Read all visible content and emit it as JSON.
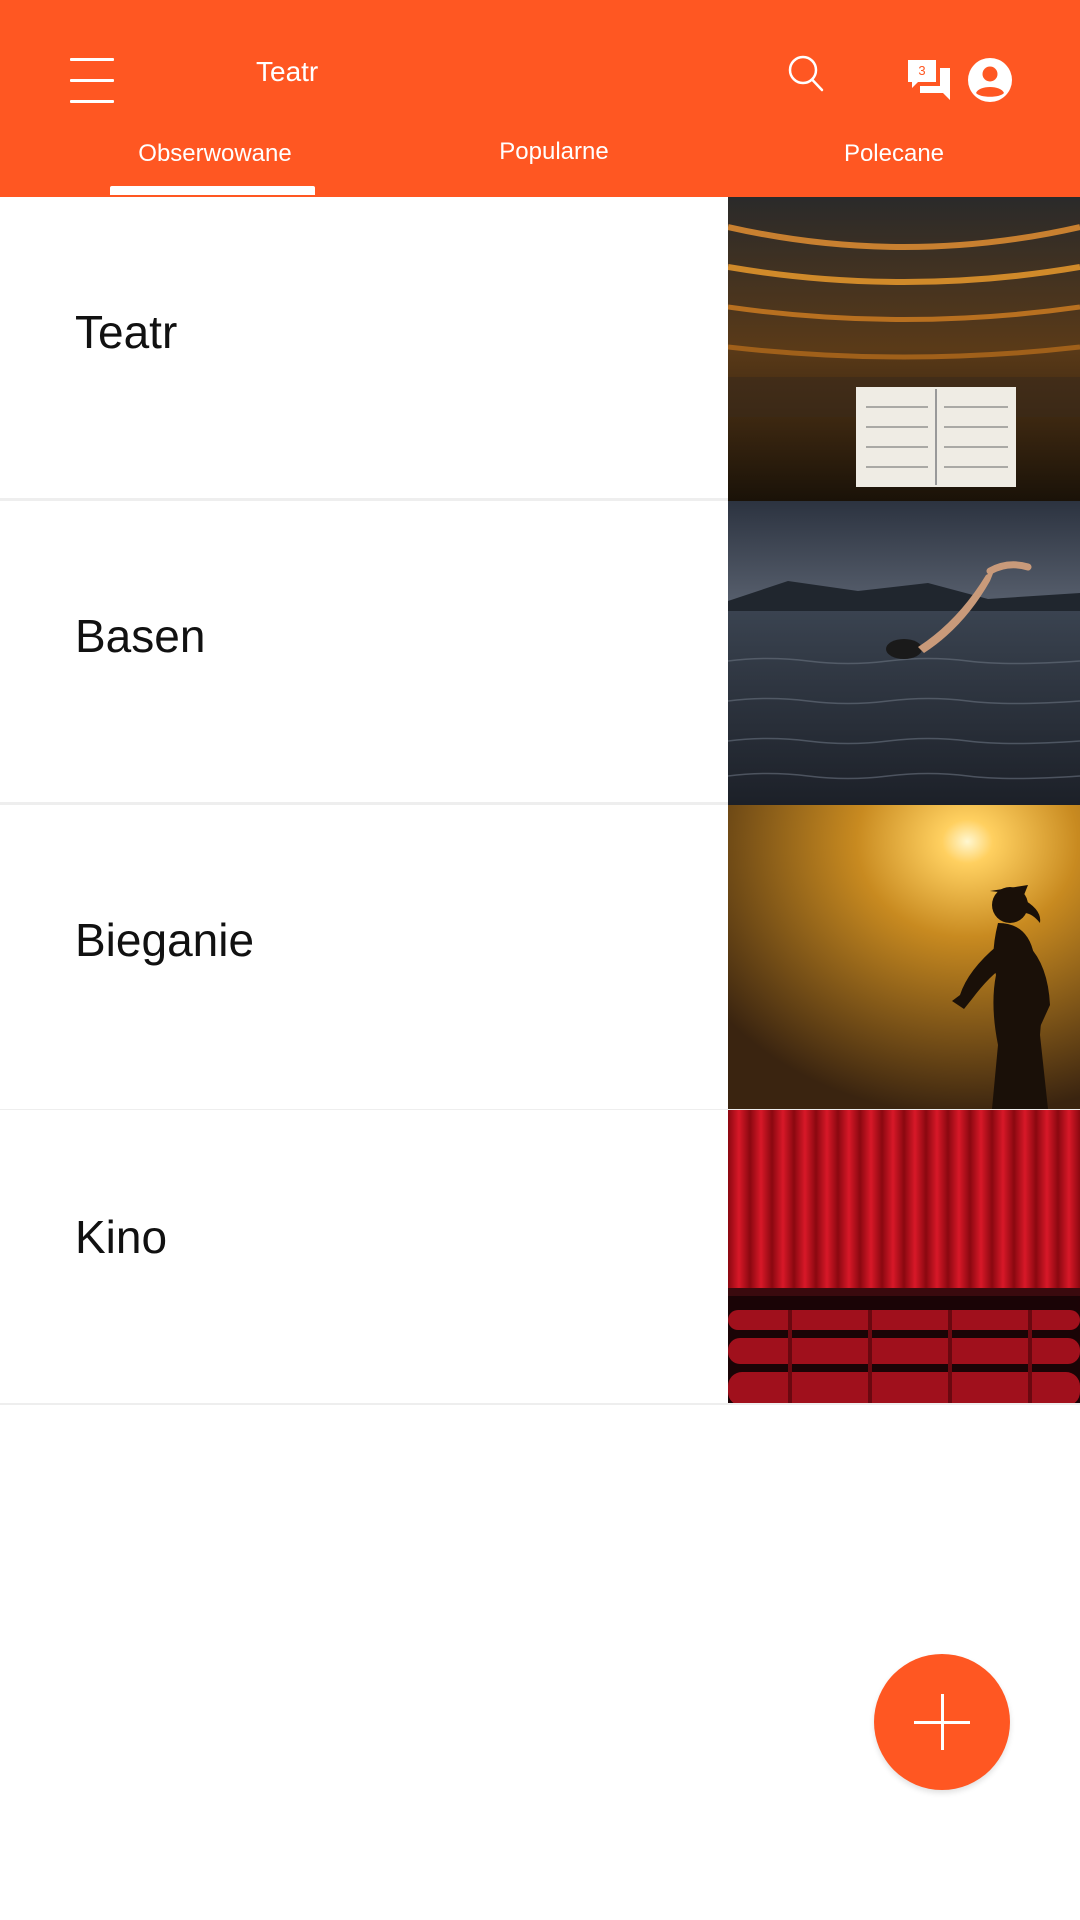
{
  "header": {
    "title": "Teatr",
    "icons": [
      "menu-icon",
      "search-icon",
      "chat-icon",
      "account-icon"
    ],
    "chat_badge": "3",
    "accent_color": "#FF5722"
  },
  "tabs": [
    {
      "label": "Obserwowane",
      "selected": true
    },
    {
      "label": "Popularne",
      "selected": false
    },
    {
      "label": "Polecane",
      "selected": false
    }
  ],
  "list": {
    "items": [
      {
        "label": "Teatr",
        "image": "theater-photo"
      },
      {
        "label": "Basen",
        "image": "swimming-photo"
      },
      {
        "label": "Bieganie",
        "image": "running-photo"
      },
      {
        "label": "Kino",
        "image": "cinema-photo"
      }
    ]
  },
  "fab": {
    "icon": "plus-icon"
  }
}
